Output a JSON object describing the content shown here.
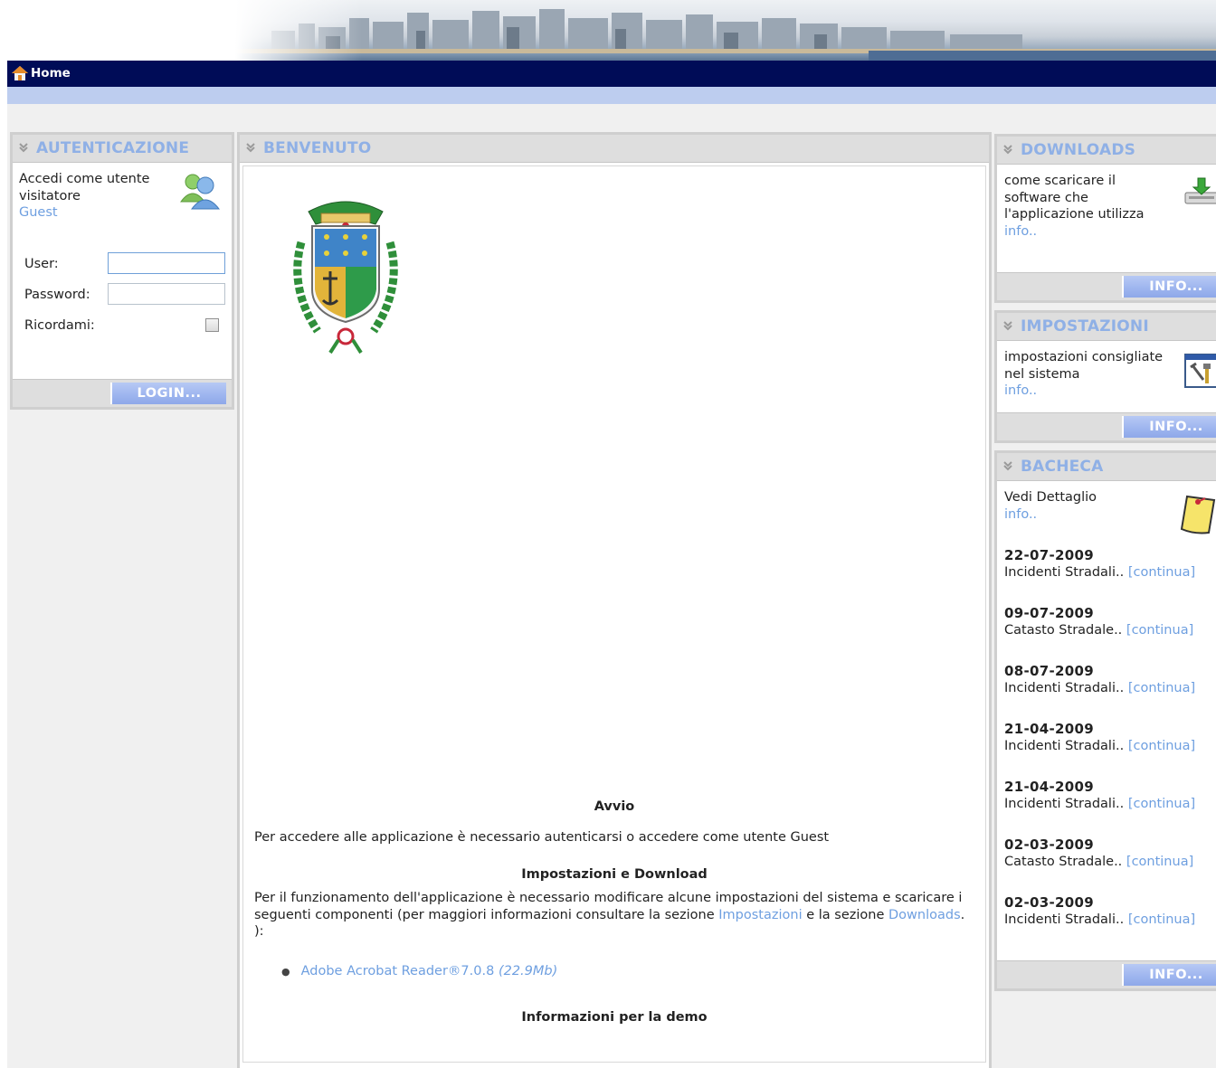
{
  "nav": {
    "home_label": "Home"
  },
  "login": {
    "title": "AUTENTICAZIONE",
    "guest_text": "Accedi come utente visitatore",
    "guest_link": "Guest",
    "user_label": "User:",
    "user_value": "",
    "password_label": "Password:",
    "password_value": "",
    "remember_label": "Ricordami:",
    "remember_checked": false,
    "button_label": "LOGIN..."
  },
  "welcome": {
    "title": "BENVENUTO",
    "avvio_heading": "Avvio",
    "avvio_text": "Per accedere alle applicazione è necessario autenticarsi o accedere come utente Guest",
    "settings_heading": "Impostazioni e Download",
    "settings_text_1": "Per il funzionamento dell'applicazione è necessario modificare alcune impostazioni del sistema e scaricare i seguenti componenti (per maggiori informazioni consultare la sezione ",
    "settings_link_1": "Impostazioni",
    "settings_text_2": " e la sezione ",
    "settings_link_2": "Downloads",
    "settings_text_3": ". ):",
    "component_name": "Adobe Acrobat Reader®7.0.8",
    "component_size": "(22.9Mb)",
    "demo_heading": "Informazioni per la demo"
  },
  "downloads": {
    "title": "DOWNLOADS",
    "text": "come scaricare il software che l'applicazione utilizza",
    "link": "info..",
    "button_label": "INFO..."
  },
  "settings": {
    "title": "IMPOSTAZIONI",
    "text": "impostazioni consigliate nel sistema",
    "link": "info..",
    "button_label": "INFO..."
  },
  "bacheca": {
    "title": "BACHECA",
    "text": "Vedi Dettaglio",
    "link": "info..",
    "button_label": "INFO...",
    "items": [
      {
        "date": "22-07-2009",
        "text": "Incidenti Stradali..",
        "link": "[continua]"
      },
      {
        "date": "09-07-2009",
        "text": "Catasto Stradale..",
        "link": "[continua]"
      },
      {
        "date": "08-07-2009",
        "text": "Incidenti Stradali..",
        "link": "[continua]"
      },
      {
        "date": "21-04-2009",
        "text": "Incidenti Stradali..",
        "link": "[continua]"
      },
      {
        "date": "21-04-2009",
        "text": "Incidenti Stradali..",
        "link": "[continua]"
      },
      {
        "date": "02-03-2009",
        "text": "Catasto Stradale..",
        "link": "[continua]"
      },
      {
        "date": "02-03-2009",
        "text": "Incidenti Stradali..",
        "link": "[continua]"
      }
    ]
  }
}
